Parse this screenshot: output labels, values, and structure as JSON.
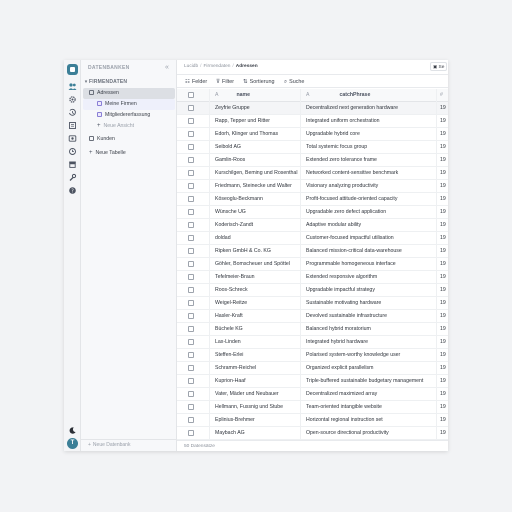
{
  "rail": {
    "icons": [
      "people-icon",
      "gear-icon",
      "history-icon",
      "book-icon",
      "image-icon",
      "clock-icon",
      "archive-icon",
      "wrench-icon",
      "help-icon"
    ],
    "bottom_icons": [
      "moon-icon"
    ],
    "avatar_letter": "T"
  },
  "sidebar": {
    "header": "DATENBANKEN",
    "collapse_glyph": "«",
    "database": "FIRMENDATEN",
    "table_adressen": "Adressen",
    "view_meine_firmen": "Meine Firmen",
    "view_mitglieder": "Mitgliedererfassung",
    "new_view": "Neue Ansicht",
    "table_kunden": "Kunden",
    "new_table": "Neue Tabelle",
    "new_database": "Neue Datenbank"
  },
  "breadcrumb": {
    "items": [
      "Lucidb",
      "Firmendaten",
      "Adressen"
    ]
  },
  "share_label": "Se",
  "toolbar": {
    "fields": "Felder",
    "filter": "Filter",
    "sort": "Sortierung",
    "search": "Suche"
  },
  "table": {
    "columns": [
      {
        "type": "A",
        "label": "name"
      },
      {
        "type": "A",
        "label": "catchPhrase"
      },
      {
        "type": "#",
        "label": ""
      }
    ],
    "rows": [
      {
        "name": "Zeyfrie Gruppe",
        "catchPhrase": "Decentralized next generation hardware",
        "year": "19"
      },
      {
        "name": "Rapp, Tepper und Ritter",
        "catchPhrase": "Integrated uniform orchestration",
        "year": "19"
      },
      {
        "name": "Edorh, Klinger und Thomas",
        "catchPhrase": "Upgradable hybrid core",
        "year": "19"
      },
      {
        "name": "Seibold AG",
        "catchPhrase": "Total systemic focus group",
        "year": "19"
      },
      {
        "name": "Gamlin-Roos",
        "catchPhrase": "Extended zero tolerance frame",
        "year": "19"
      },
      {
        "name": "Kurschilgen, Beming und Rosenthal",
        "catchPhrase": "Networked content-sensitive benchmark",
        "year": "19"
      },
      {
        "name": "Friedmann, Steinecke und Walter",
        "catchPhrase": "Visionary analyzing productivity",
        "year": "19"
      },
      {
        "name": "Köseoglu-Beckmann",
        "catchPhrase": "Profit-focused attitude-oriented capacity",
        "year": "19"
      },
      {
        "name": "Wünsche UG",
        "catchPhrase": "Upgradable zero defect application",
        "year": "19"
      },
      {
        "name": "Koderisch-Zandt",
        "catchPhrase": "Adaptive modular ability",
        "year": "19"
      },
      {
        "name": "doldad",
        "catchPhrase": "Customer-focused impactful utilisation",
        "year": "19"
      },
      {
        "name": "Ripken GmbH & Co. KG",
        "catchPhrase": "Balanced mission-critical data-warehouse",
        "year": "19"
      },
      {
        "name": "Göhler, Bomscheuer und Spöttel",
        "catchPhrase": "Programmable homogeneous interface",
        "year": "19"
      },
      {
        "name": "Tefelmeier-Braun",
        "catchPhrase": "Extended responsive algorithm",
        "year": "19"
      },
      {
        "name": "Roos-Schreck",
        "catchPhrase": "Upgradable impactful strategy",
        "year": "19"
      },
      {
        "name": "Weigel-Reitze",
        "catchPhrase": "Sustainable motivating hardware",
        "year": "19"
      },
      {
        "name": "Hasler-Kraft",
        "catchPhrase": "Devolved sustainable infrastructure",
        "year": "19"
      },
      {
        "name": "Büchele KG",
        "catchPhrase": "Balanced hybrid moratorium",
        "year": "19"
      },
      {
        "name": "Lax-Linden",
        "catchPhrase": "Integrated hybrid hardware",
        "year": "19"
      },
      {
        "name": "Steffen-Erlei",
        "catchPhrase": "Polarised system-worthy knowledge user",
        "year": "19"
      },
      {
        "name": "Schramm-Reichel",
        "catchPhrase": "Organized explicit parallelism",
        "year": "19"
      },
      {
        "name": "Kuprion-Haaf",
        "catchPhrase": "Triple-buffered sustainable budgetary management",
        "year": "19"
      },
      {
        "name": "Vater, Mäder und Neubauer",
        "catchPhrase": "Decentralized maximized array",
        "year": "19"
      },
      {
        "name": "Hellmann, Fussnig und Stube",
        "catchPhrase": "Team-oriented intangible website",
        "year": "19"
      },
      {
        "name": "Eplinius-Brehmer",
        "catchPhrase": "Horizontal regional instruction set",
        "year": "19"
      },
      {
        "name": "Maybach AG",
        "catchPhrase": "Open-source directional productivity",
        "year": "19"
      }
    ]
  },
  "status": {
    "records": "50 Datensätze"
  }
}
